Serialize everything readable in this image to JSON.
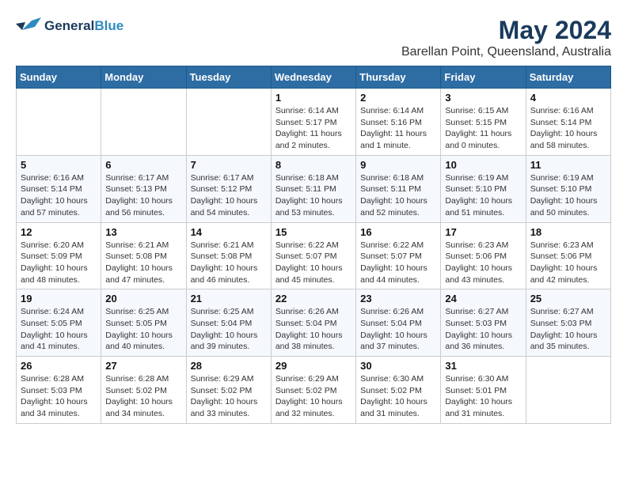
{
  "app": {
    "logo_general": "General",
    "logo_blue": "Blue",
    "title": "May 2024",
    "subtitle": "Barellan Point, Queensland, Australia"
  },
  "calendar": {
    "headers": [
      "Sunday",
      "Monday",
      "Tuesday",
      "Wednesday",
      "Thursday",
      "Friday",
      "Saturday"
    ],
    "weeks": [
      [
        {
          "day": "",
          "sunrise": "",
          "sunset": "",
          "daylight": ""
        },
        {
          "day": "",
          "sunrise": "",
          "sunset": "",
          "daylight": ""
        },
        {
          "day": "",
          "sunrise": "",
          "sunset": "",
          "daylight": ""
        },
        {
          "day": "1",
          "sunrise": "Sunrise: 6:14 AM",
          "sunset": "Sunset: 5:17 PM",
          "daylight": "Daylight: 11 hours and 2 minutes."
        },
        {
          "day": "2",
          "sunrise": "Sunrise: 6:14 AM",
          "sunset": "Sunset: 5:16 PM",
          "daylight": "Daylight: 11 hours and 1 minute."
        },
        {
          "day": "3",
          "sunrise": "Sunrise: 6:15 AM",
          "sunset": "Sunset: 5:15 PM",
          "daylight": "Daylight: 11 hours and 0 minutes."
        },
        {
          "day": "4",
          "sunrise": "Sunrise: 6:16 AM",
          "sunset": "Sunset: 5:14 PM",
          "daylight": "Daylight: 10 hours and 58 minutes."
        }
      ],
      [
        {
          "day": "5",
          "sunrise": "Sunrise: 6:16 AM",
          "sunset": "Sunset: 5:14 PM",
          "daylight": "Daylight: 10 hours and 57 minutes."
        },
        {
          "day": "6",
          "sunrise": "Sunrise: 6:17 AM",
          "sunset": "Sunset: 5:13 PM",
          "daylight": "Daylight: 10 hours and 56 minutes."
        },
        {
          "day": "7",
          "sunrise": "Sunrise: 6:17 AM",
          "sunset": "Sunset: 5:12 PM",
          "daylight": "Daylight: 10 hours and 54 minutes."
        },
        {
          "day": "8",
          "sunrise": "Sunrise: 6:18 AM",
          "sunset": "Sunset: 5:11 PM",
          "daylight": "Daylight: 10 hours and 53 minutes."
        },
        {
          "day": "9",
          "sunrise": "Sunrise: 6:18 AM",
          "sunset": "Sunset: 5:11 PM",
          "daylight": "Daylight: 10 hours and 52 minutes."
        },
        {
          "day": "10",
          "sunrise": "Sunrise: 6:19 AM",
          "sunset": "Sunset: 5:10 PM",
          "daylight": "Daylight: 10 hours and 51 minutes."
        },
        {
          "day": "11",
          "sunrise": "Sunrise: 6:19 AM",
          "sunset": "Sunset: 5:10 PM",
          "daylight": "Daylight: 10 hours and 50 minutes."
        }
      ],
      [
        {
          "day": "12",
          "sunrise": "Sunrise: 6:20 AM",
          "sunset": "Sunset: 5:09 PM",
          "daylight": "Daylight: 10 hours and 48 minutes."
        },
        {
          "day": "13",
          "sunrise": "Sunrise: 6:21 AM",
          "sunset": "Sunset: 5:08 PM",
          "daylight": "Daylight: 10 hours and 47 minutes."
        },
        {
          "day": "14",
          "sunrise": "Sunrise: 6:21 AM",
          "sunset": "Sunset: 5:08 PM",
          "daylight": "Daylight: 10 hours and 46 minutes."
        },
        {
          "day": "15",
          "sunrise": "Sunrise: 6:22 AM",
          "sunset": "Sunset: 5:07 PM",
          "daylight": "Daylight: 10 hours and 45 minutes."
        },
        {
          "day": "16",
          "sunrise": "Sunrise: 6:22 AM",
          "sunset": "Sunset: 5:07 PM",
          "daylight": "Daylight: 10 hours and 44 minutes."
        },
        {
          "day": "17",
          "sunrise": "Sunrise: 6:23 AM",
          "sunset": "Sunset: 5:06 PM",
          "daylight": "Daylight: 10 hours and 43 minutes."
        },
        {
          "day": "18",
          "sunrise": "Sunrise: 6:23 AM",
          "sunset": "Sunset: 5:06 PM",
          "daylight": "Daylight: 10 hours and 42 minutes."
        }
      ],
      [
        {
          "day": "19",
          "sunrise": "Sunrise: 6:24 AM",
          "sunset": "Sunset: 5:05 PM",
          "daylight": "Daylight: 10 hours and 41 minutes."
        },
        {
          "day": "20",
          "sunrise": "Sunrise: 6:25 AM",
          "sunset": "Sunset: 5:05 PM",
          "daylight": "Daylight: 10 hours and 40 minutes."
        },
        {
          "day": "21",
          "sunrise": "Sunrise: 6:25 AM",
          "sunset": "Sunset: 5:04 PM",
          "daylight": "Daylight: 10 hours and 39 minutes."
        },
        {
          "day": "22",
          "sunrise": "Sunrise: 6:26 AM",
          "sunset": "Sunset: 5:04 PM",
          "daylight": "Daylight: 10 hours and 38 minutes."
        },
        {
          "day": "23",
          "sunrise": "Sunrise: 6:26 AM",
          "sunset": "Sunset: 5:04 PM",
          "daylight": "Daylight: 10 hours and 37 minutes."
        },
        {
          "day": "24",
          "sunrise": "Sunrise: 6:27 AM",
          "sunset": "Sunset: 5:03 PM",
          "daylight": "Daylight: 10 hours and 36 minutes."
        },
        {
          "day": "25",
          "sunrise": "Sunrise: 6:27 AM",
          "sunset": "Sunset: 5:03 PM",
          "daylight": "Daylight: 10 hours and 35 minutes."
        }
      ],
      [
        {
          "day": "26",
          "sunrise": "Sunrise: 6:28 AM",
          "sunset": "Sunset: 5:03 PM",
          "daylight": "Daylight: 10 hours and 34 minutes."
        },
        {
          "day": "27",
          "sunrise": "Sunrise: 6:28 AM",
          "sunset": "Sunset: 5:02 PM",
          "daylight": "Daylight: 10 hours and 34 minutes."
        },
        {
          "day": "28",
          "sunrise": "Sunrise: 6:29 AM",
          "sunset": "Sunset: 5:02 PM",
          "daylight": "Daylight: 10 hours and 33 minutes."
        },
        {
          "day": "29",
          "sunrise": "Sunrise: 6:29 AM",
          "sunset": "Sunset: 5:02 PM",
          "daylight": "Daylight: 10 hours and 32 minutes."
        },
        {
          "day": "30",
          "sunrise": "Sunrise: 6:30 AM",
          "sunset": "Sunset: 5:02 PM",
          "daylight": "Daylight: 10 hours and 31 minutes."
        },
        {
          "day": "31",
          "sunrise": "Sunrise: 6:30 AM",
          "sunset": "Sunset: 5:01 PM",
          "daylight": "Daylight: 10 hours and 31 minutes."
        },
        {
          "day": "",
          "sunrise": "",
          "sunset": "",
          "daylight": ""
        }
      ]
    ]
  }
}
